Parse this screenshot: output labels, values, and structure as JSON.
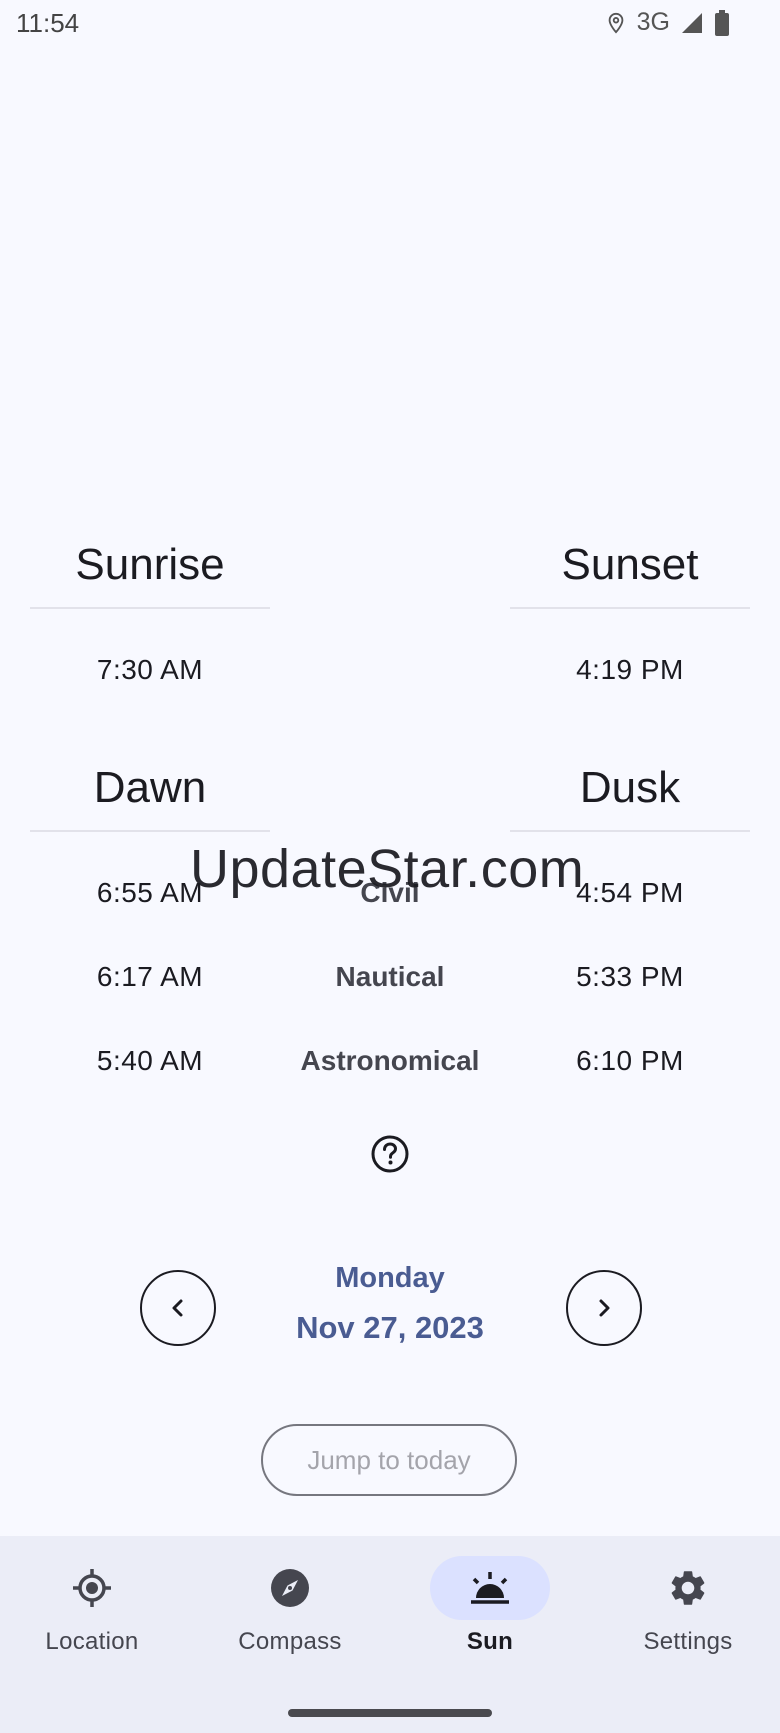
{
  "status_bar": {
    "time": "11:54",
    "network": "3G"
  },
  "sun": {
    "sunrise_title": "Sunrise",
    "sunset_title": "Sunset",
    "sunrise_time": "7:30 AM",
    "sunset_time": "4:19 PM",
    "dawn_title": "Dawn",
    "dusk_title": "Dusk",
    "twilight": [
      {
        "label": "Civil",
        "dawn": "6:55 AM",
        "dusk": "4:54 PM"
      },
      {
        "label": "Nautical",
        "dawn": "6:17 AM",
        "dusk": "5:33 PM"
      },
      {
        "label": "Astronomical",
        "dawn": "5:40 AM",
        "dusk": "6:10 PM"
      }
    ]
  },
  "watermark": "UpdateStar.com",
  "date": {
    "weekday": "Monday",
    "full": "Nov 27, 2023"
  },
  "jump_button": "Jump to today",
  "nav": [
    {
      "label": "Location",
      "icon": "location-icon",
      "active": false
    },
    {
      "label": "Compass",
      "icon": "compass-icon",
      "active": false
    },
    {
      "label": "Sun",
      "icon": "sunset-icon",
      "active": true
    },
    {
      "label": "Settings",
      "icon": "gear-icon",
      "active": false
    }
  ],
  "colors": {
    "accent": "#4a5c92",
    "active_pill": "#dbe1ff",
    "nav_bg": "#ebedf7"
  }
}
